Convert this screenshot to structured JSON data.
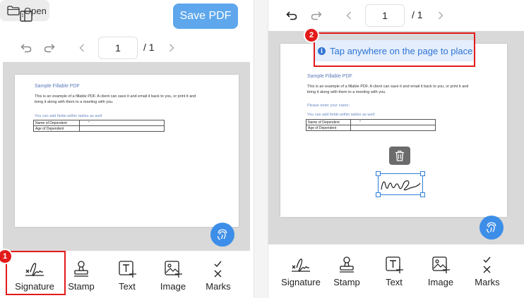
{
  "colors": {
    "accent": "#5ea7ec",
    "fab": "#3d8ee8",
    "highlight": "#e31a1a",
    "toast_text": "#2f74d6"
  },
  "left": {
    "open_label": "Open",
    "save_label": "Save PDF",
    "page_number": "1",
    "page_total": "/ 1",
    "step_badge": "1"
  },
  "right": {
    "page_number": "1",
    "page_total": "/ 1",
    "step_badge": "2",
    "toast": "Tap anywhere on the page to place",
    "pdf_extra": "Please enter your name:"
  },
  "pdf": {
    "title": "Sample Fillable PDF",
    "body_line1": "This is an example of a fillable PDF. A client can save it and email it back to you, or print it and",
    "body_line2": "bring it along with them to a meeting with you.",
    "tables_note": "You can add  fields within tables as well:",
    "rows": [
      {
        "label": "Name of Dependent",
        "value": "\""
      },
      {
        "label": "Age of Dependent",
        "value": ""
      }
    ]
  },
  "tools": [
    {
      "name": "signature",
      "label": "Signature",
      "icon": "signature-icon"
    },
    {
      "name": "stamp",
      "label": "Stamp",
      "icon": "stamp-icon"
    },
    {
      "name": "text",
      "label": "Text",
      "icon": "text-icon"
    },
    {
      "name": "image",
      "label": "Image",
      "icon": "image-icon"
    },
    {
      "name": "marks",
      "label": "Marks",
      "icon": "marks-icon"
    }
  ]
}
